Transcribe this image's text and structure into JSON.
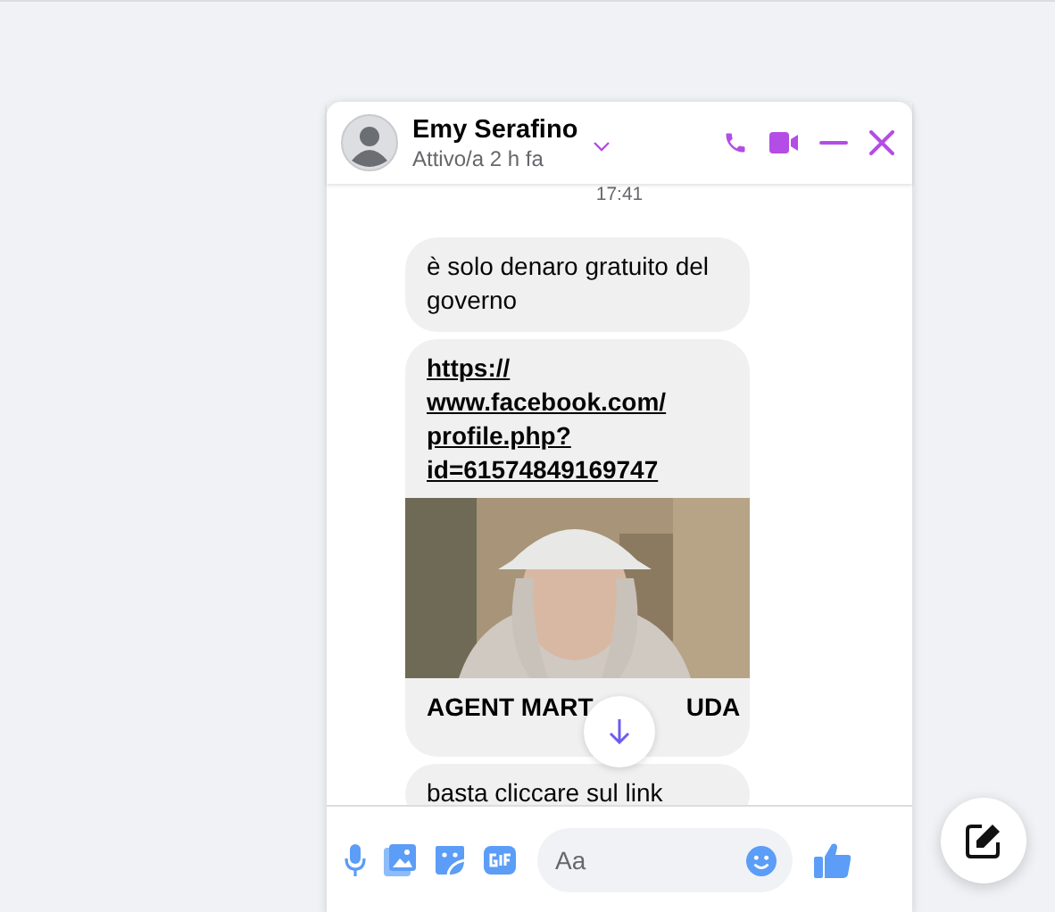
{
  "chat": {
    "contact": {
      "name": "Emy Serafino",
      "status": "Attivo/a 2 h fa"
    },
    "timestamp": "17:41",
    "messages": [
      {
        "kind": "text",
        "text": "è solo denaro gratuito del governo"
      },
      {
        "kind": "link",
        "url": "https://www.facebook.com/profile.php?id=61574849169747",
        "preview": {
          "kind": "picture",
          "title_parts": [
            "AGENT MART",
            "UDA"
          ]
        }
      },
      {
        "kind": "text",
        "text": "basta cliccare sul link"
      }
    ],
    "composer": {
      "placeholder": "Aa"
    }
  }
}
